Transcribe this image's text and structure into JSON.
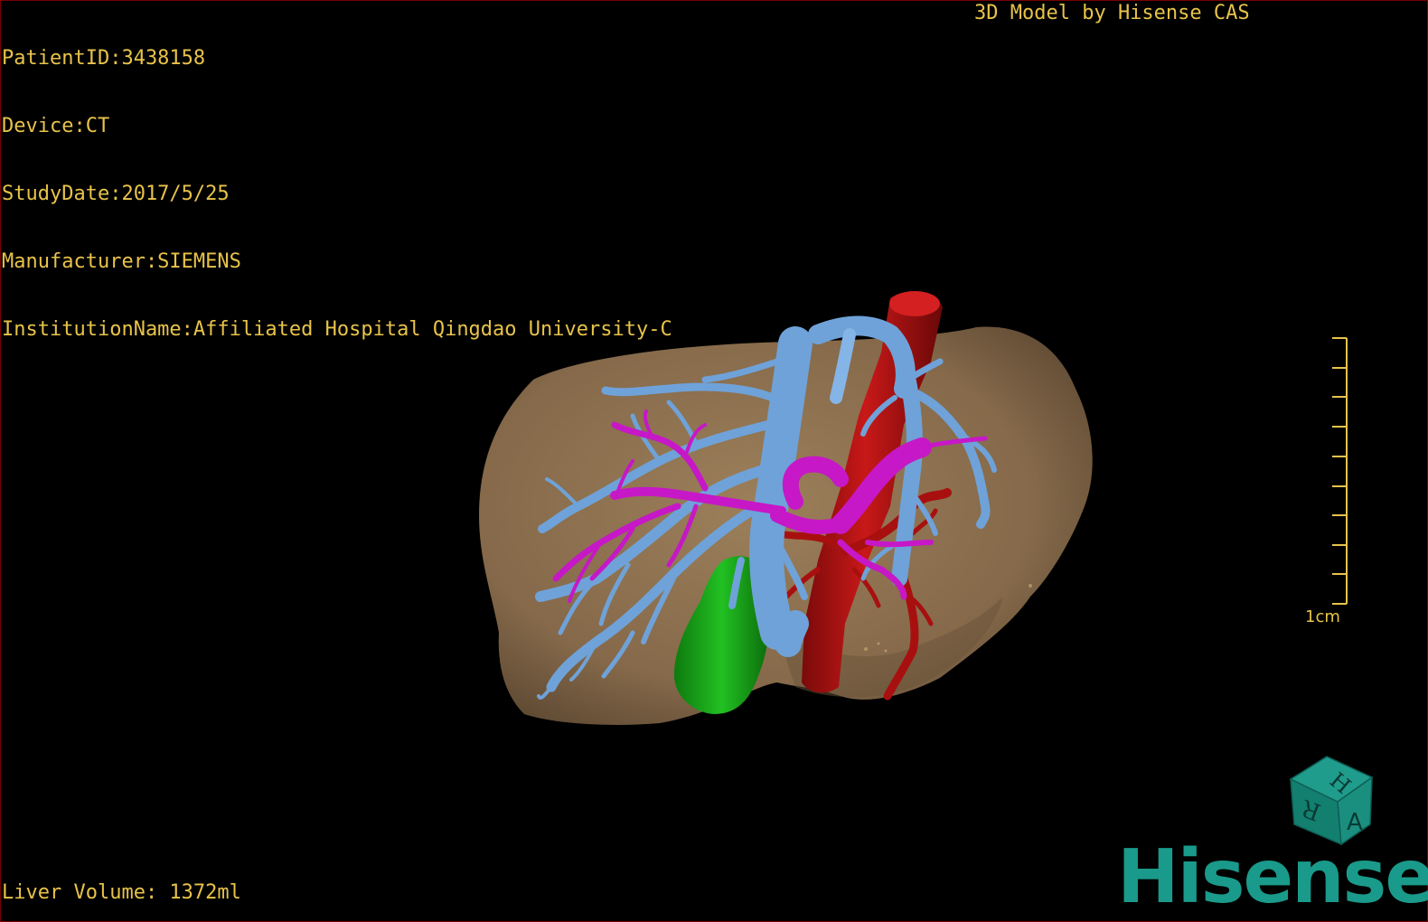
{
  "header": {
    "patient_id": "PatientID:3438158",
    "device": "Device:CT",
    "study_date": "StudyDate:2017/5/25",
    "manufacturer": "Manufacturer:SIEMENS",
    "institution": "InstitutionName:Affiliated Hospital Qingdao University-C"
  },
  "brand_caption": "3D Model by Hisense CAS",
  "footer": {
    "liver_volume": "Liver Volume: 1372ml"
  },
  "scale_bar": {
    "label": "1cm"
  },
  "orientation_cube": {
    "face_a": "A",
    "face_h": "H",
    "face_r": "R"
  },
  "logo": {
    "text": "Hisense"
  },
  "colors": {
    "text": "#e8c34a",
    "liver": "#8e7351",
    "portal_vein": "#6fa2d8",
    "hepatic_vein": "#c618c6",
    "artery_ivc": "#b01212",
    "gallbladder": "#18a818",
    "brand": "#1a9a8a"
  }
}
